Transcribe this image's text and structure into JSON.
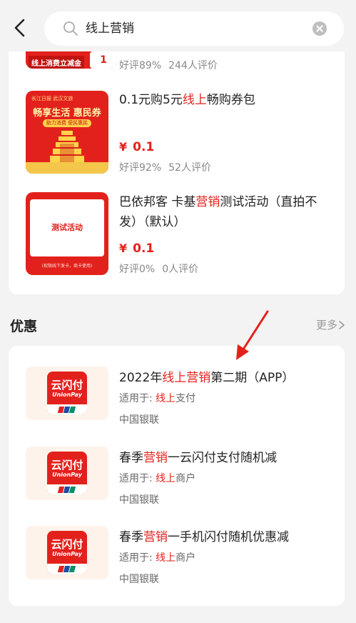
{
  "search": {
    "query": "线上营销"
  },
  "products": [
    {
      "rating_good": "好评89%",
      "rating_count": "244人评价",
      "thumb_tag": "线上消费立减金",
      "thumb_badge": "1"
    },
    {
      "title_parts": [
        "0.1元购5元",
        "线上",
        "畅购券包"
      ],
      "currency": "¥",
      "price": "0.1",
      "rating_good": "好评92%",
      "rating_count": "52人评价",
      "poster": {
        "top": "长江日报 武汉文旅",
        "slogan": "畅享生活 惠民券",
        "sub": "助力消费 便民惠民"
      }
    },
    {
      "title_parts": [
        "巴依邦客 卡基",
        "营销",
        "测试活动（直拍不发）（默认）"
      ],
      "currency": "¥",
      "price": "0.1",
      "rating_good": "好评0%",
      "rating_count": "0人评价",
      "poster": {
        "inner": "测试活动",
        "foot": "(权限线下发卡，商卡使用)"
      }
    }
  ],
  "section": {
    "title": "优惠",
    "more": "更多"
  },
  "coupons": [
    {
      "title_parts": [
        "2022年",
        "线上营销",
        "第二期（APP）"
      ],
      "scope_label": "适用于: ",
      "scope_hl": "线上",
      "scope_rest": "支付",
      "bank": "中国银联"
    },
    {
      "title_parts": [
        "春季",
        "营销",
        "一云闪付支付随机减"
      ],
      "scope_label": "适用于: ",
      "scope_hl": "线上",
      "scope_rest": "商户",
      "bank": "中国银联"
    },
    {
      "title_parts": [
        "春季",
        "营销",
        "一手机闪付随机优惠减"
      ],
      "scope_label": "适用于: ",
      "scope_hl": "线上",
      "scope_rest": "商户",
      "bank": "中国银联"
    }
  ],
  "logo": {
    "cn": "云闪付",
    "en": "UnionPay"
  },
  "colors": {
    "accent": "#e3211c",
    "background": "#f3f3f3",
    "card": "#ffffff",
    "logo_bg": "#fdf3ea"
  },
  "icons": {
    "back": "chevron-left-icon",
    "search": "search-icon",
    "clear": "clear-icon",
    "more": "chevron-right-icon",
    "annotation": "red-arrow-icon"
  }
}
